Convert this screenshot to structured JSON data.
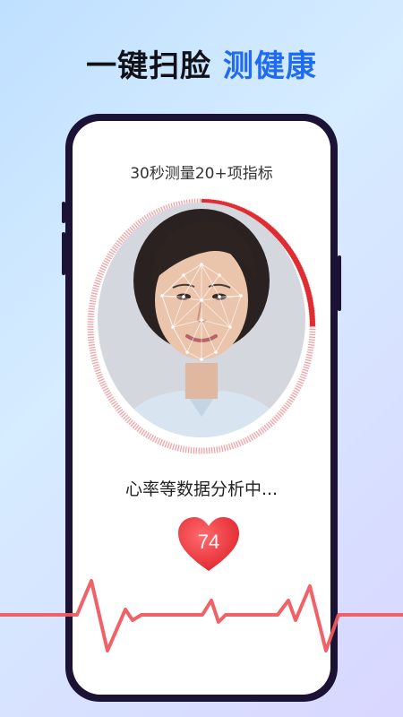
{
  "headline": {
    "part1": "一键扫脸",
    "part2": "测健康"
  },
  "screen": {
    "subtitle": "30秒测量20+项指标",
    "status": "心率等数据分析中...",
    "heart_rate": "74"
  },
  "colors": {
    "headline_dark": "#111118",
    "headline_blue": "#1f6cf2",
    "phone_frame": "#1b1236",
    "accent_red": "#e8333a"
  },
  "icons": {
    "heart": "heart-icon"
  }
}
